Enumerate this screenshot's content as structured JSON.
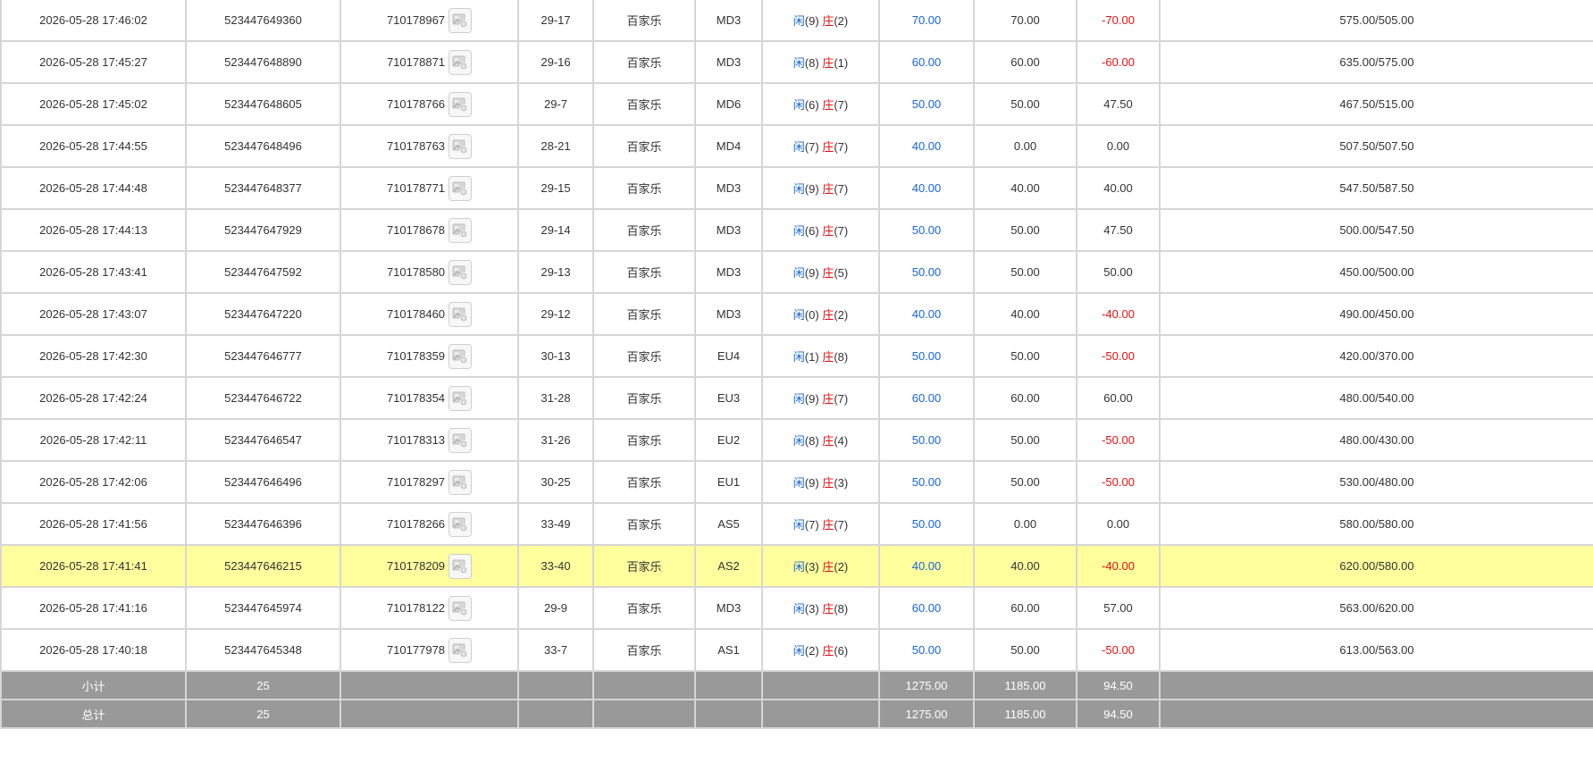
{
  "colors": {
    "blue": "#1565d8",
    "red": "#e61010",
    "highlight": "#ffff9e",
    "summary_bg": "#999999"
  },
  "labels": {
    "xian": "闲",
    "zhuang": "庄"
  },
  "rows": [
    {
      "time": "2026-05-28 17:46:02",
      "order": "523447649360",
      "game_id": "710178967",
      "shoe": "29-17",
      "game": "百家乐",
      "table": "MD3",
      "xian": "(9)",
      "zhuang": "(2)",
      "bet": "70.00",
      "valid": "70.00",
      "win": "-70.00",
      "balance": "575.00/505.00",
      "highlight": false
    },
    {
      "time": "2026-05-28 17:45:27",
      "order": "523447648890",
      "game_id": "710178871",
      "shoe": "29-16",
      "game": "百家乐",
      "table": "MD3",
      "xian": "(8)",
      "zhuang": "(1)",
      "bet": "60.00",
      "valid": "60.00",
      "win": "-60.00",
      "balance": "635.00/575.00",
      "highlight": false
    },
    {
      "time": "2026-05-28 17:45:02",
      "order": "523447648605",
      "game_id": "710178766",
      "shoe": "29-7",
      "game": "百家乐",
      "table": "MD6",
      "xian": "(6)",
      "zhuang": "(7)",
      "bet": "50.00",
      "valid": "50.00",
      "win": "47.50",
      "balance": "467.50/515.00",
      "highlight": false
    },
    {
      "time": "2026-05-28 17:44:55",
      "order": "523447648496",
      "game_id": "710178763",
      "shoe": "28-21",
      "game": "百家乐",
      "table": "MD4",
      "xian": "(7)",
      "zhuang": "(7)",
      "bet": "40.00",
      "valid": "0.00",
      "win": "0.00",
      "balance": "507.50/507.50",
      "highlight": false
    },
    {
      "time": "2026-05-28 17:44:48",
      "order": "523447648377",
      "game_id": "710178771",
      "shoe": "29-15",
      "game": "百家乐",
      "table": "MD3",
      "xian": "(9)",
      "zhuang": "(7)",
      "bet": "40.00",
      "valid": "40.00",
      "win": "40.00",
      "balance": "547.50/587.50",
      "highlight": false
    },
    {
      "time": "2026-05-28 17:44:13",
      "order": "523447647929",
      "game_id": "710178678",
      "shoe": "29-14",
      "game": "百家乐",
      "table": "MD3",
      "xian": "(6)",
      "zhuang": "(7)",
      "bet": "50.00",
      "valid": "50.00",
      "win": "47.50",
      "balance": "500.00/547.50",
      "highlight": false
    },
    {
      "time": "2026-05-28 17:43:41",
      "order": "523447647592",
      "game_id": "710178580",
      "shoe": "29-13",
      "game": "百家乐",
      "table": "MD3",
      "xian": "(9)",
      "zhuang": "(5)",
      "bet": "50.00",
      "valid": "50.00",
      "win": "50.00",
      "balance": "450.00/500.00",
      "highlight": false
    },
    {
      "time": "2026-05-28 17:43:07",
      "order": "523447647220",
      "game_id": "710178460",
      "shoe": "29-12",
      "game": "百家乐",
      "table": "MD3",
      "xian": "(0)",
      "zhuang": "(2)",
      "bet": "40.00",
      "valid": "40.00",
      "win": "-40.00",
      "balance": "490.00/450.00",
      "highlight": false
    },
    {
      "time": "2026-05-28 17:42:30",
      "order": "523447646777",
      "game_id": "710178359",
      "shoe": "30-13",
      "game": "百家乐",
      "table": "EU4",
      "xian": "(1)",
      "zhuang": "(8)",
      "bet": "50.00",
      "valid": "50.00",
      "win": "-50.00",
      "balance": "420.00/370.00",
      "highlight": false
    },
    {
      "time": "2026-05-28 17:42:24",
      "order": "523447646722",
      "game_id": "710178354",
      "shoe": "31-28",
      "game": "百家乐",
      "table": "EU3",
      "xian": "(9)",
      "zhuang": "(7)",
      "bet": "60.00",
      "valid": "60.00",
      "win": "60.00",
      "balance": "480.00/540.00",
      "highlight": false
    },
    {
      "time": "2026-05-28 17:42:11",
      "order": "523447646547",
      "game_id": "710178313",
      "shoe": "31-26",
      "game": "百家乐",
      "table": "EU2",
      "xian": "(8)",
      "zhuang": "(4)",
      "bet": "50.00",
      "valid": "50.00",
      "win": "-50.00",
      "balance": "480.00/430.00",
      "highlight": false
    },
    {
      "time": "2026-05-28 17:42:06",
      "order": "523447646496",
      "game_id": "710178297",
      "shoe": "30-25",
      "game": "百家乐",
      "table": "EU1",
      "xian": "(9)",
      "zhuang": "(3)",
      "bet": "50.00",
      "valid": "50.00",
      "win": "-50.00",
      "balance": "530.00/480.00",
      "highlight": false
    },
    {
      "time": "2026-05-28 17:41:56",
      "order": "523447646396",
      "game_id": "710178266",
      "shoe": "33-49",
      "game": "百家乐",
      "table": "AS5",
      "xian": "(7)",
      "zhuang": "(7)",
      "bet": "50.00",
      "valid": "0.00",
      "win": "0.00",
      "balance": "580.00/580.00",
      "highlight": false
    },
    {
      "time": "2026-05-28 17:41:41",
      "order": "523447646215",
      "game_id": "710178209",
      "shoe": "33-40",
      "game": "百家乐",
      "table": "AS2",
      "xian": "(3)",
      "zhuang": "(2)",
      "bet": "40.00",
      "valid": "40.00",
      "win": "-40.00",
      "balance": "620.00/580.00",
      "highlight": true
    },
    {
      "time": "2026-05-28 17:41:16",
      "order": "523447645974",
      "game_id": "710178122",
      "shoe": "29-9",
      "game": "百家乐",
      "table": "MD3",
      "xian": "(3)",
      "zhuang": "(8)",
      "bet": "60.00",
      "valid": "60.00",
      "win": "57.00",
      "balance": "563.00/620.00",
      "highlight": false
    },
    {
      "time": "2026-05-28 17:40:18",
      "order": "523447645348",
      "game_id": "710177978",
      "shoe": "33-7",
      "game": "百家乐",
      "table": "AS1",
      "xian": "(2)",
      "zhuang": "(6)",
      "bet": "50.00",
      "valid": "50.00",
      "win": "-50.00",
      "balance": "613.00/563.00",
      "highlight": false
    }
  ],
  "subtotal": {
    "label": "小计",
    "count": "25",
    "bet": "1275.00",
    "valid": "1185.00",
    "win": "94.50"
  },
  "total": {
    "label": "总计",
    "count": "25",
    "bet": "1275.00",
    "valid": "1185.00",
    "win": "94.50"
  }
}
